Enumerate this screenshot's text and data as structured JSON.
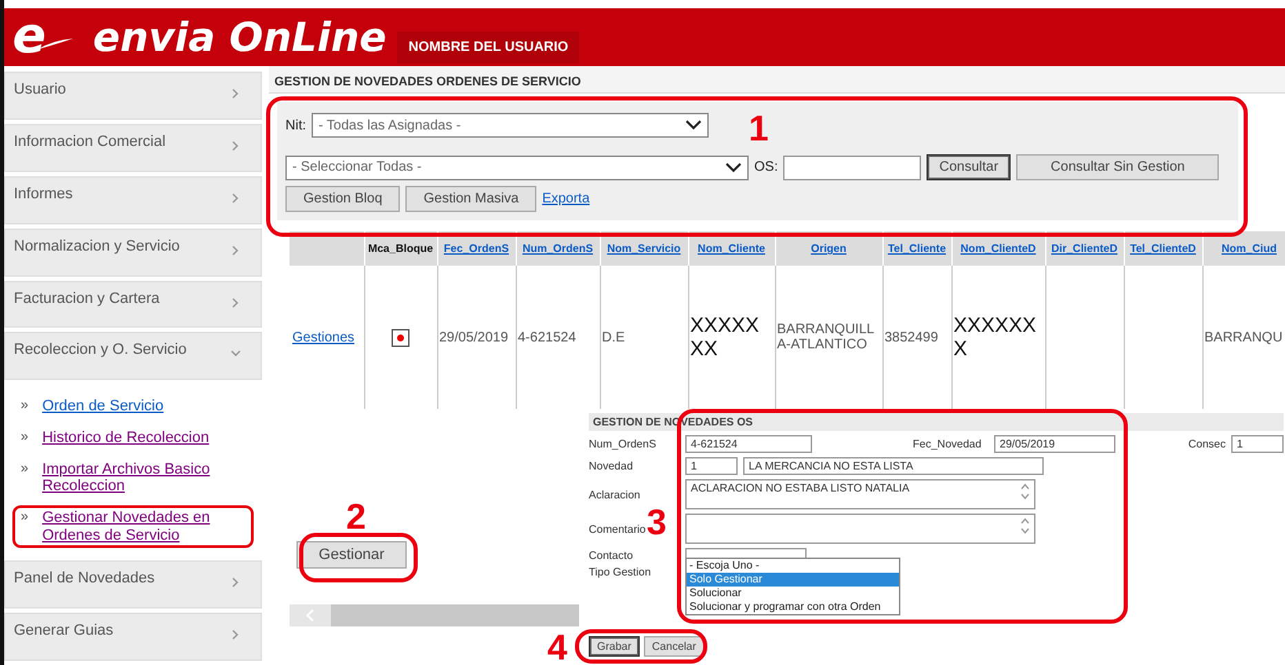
{
  "header": {
    "logo_mark": "e",
    "logo_text": "envia OnLine",
    "user_name": "NOMBRE DEL USUARIO"
  },
  "sidebar": {
    "items": [
      {
        "label": "Usuario",
        "expanded": false
      },
      {
        "label": "Informacion Comercial",
        "expanded": false
      },
      {
        "label": "Informes",
        "expanded": false
      },
      {
        "label": "Normalizacion y Servicio",
        "expanded": false
      },
      {
        "label": "Facturacion y Cartera",
        "expanded": false
      },
      {
        "label": "Recoleccion y O. Servicio",
        "expanded": true,
        "children": [
          {
            "bullet": "»",
            "label": "Orden de Servicio",
            "visited": false,
            "highlighted": false
          },
          {
            "bullet": "»",
            "label": "Historico de Recoleccion",
            "visited": true,
            "highlighted": false
          },
          {
            "bullet": "»",
            "label": "Importar Archivos Basico Recoleccion",
            "visited": true,
            "highlighted": false
          },
          {
            "bullet": "»",
            "label": "Gestionar Novedades en Ordenes de Servicio",
            "visited": true,
            "highlighted": true
          }
        ]
      },
      {
        "label": "Panel de Novedades",
        "expanded": false
      },
      {
        "label": "Generar Guias",
        "expanded": false
      }
    ]
  },
  "page_title": "GESTION DE NOVEDADES ORDENES DE SERVICIO",
  "filters": {
    "nit_label": "Nit:",
    "nit_select": "- Todas las Asignadas -",
    "service_select": "- Seleccionar Todas -",
    "os_label": "OS:",
    "buttons": [
      {
        "label": "Consultar",
        "focused": true
      },
      {
        "label": "Consultar Sin Gestion",
        "focused": false
      }
    ],
    "row2_buttons": [
      "Gestion Bloq",
      "Gestion Masiva"
    ],
    "export_link": "Exporta"
  },
  "table": {
    "columns": [
      {
        "kind": "blank"
      },
      {
        "label": "Mca_Bloque",
        "link": false
      },
      {
        "label": "Fec_OrdenS",
        "link": true
      },
      {
        "label": "Num_OrdenS",
        "link": true
      },
      {
        "label": "Nom_Servicio",
        "link": true
      },
      {
        "label": "Nom_Cliente",
        "link": true
      },
      {
        "label": "Origen",
        "link": true
      },
      {
        "label": "Tel_Cliente",
        "link": true
      },
      {
        "label": "Nom_ClienteD",
        "link": true
      },
      {
        "label": "Dir_ClienteD",
        "link": true
      },
      {
        "label": "Tel_ClienteD",
        "link": true
      },
      {
        "label": "Nom_Ciud",
        "link": true
      }
    ],
    "rows": [
      {
        "cells": [
          {
            "kind": "link",
            "text": "Gestiones"
          },
          {
            "kind": "flag",
            "blocked": true
          },
          {
            "kind": "plain",
            "text": "29/05/2019"
          },
          {
            "kind": "plain",
            "text": "4-621524"
          },
          {
            "kind": "plain",
            "text": "D.E"
          },
          {
            "kind": "masked",
            "text": "XXXXXXX"
          },
          {
            "kind": "plain",
            "text": "BARRANQUILLA-ATLANTICO"
          },
          {
            "kind": "plain",
            "text": "3852499"
          },
          {
            "kind": "masked",
            "text": "XXXXXXX"
          },
          {
            "kind": "empty"
          },
          {
            "kind": "empty"
          },
          {
            "kind": "plain",
            "text": "BARRANQU"
          }
        ]
      }
    ]
  },
  "gestionar_button": "Gestionar",
  "form": {
    "title": "GESTION DE NOVEDADES OS",
    "num_label": "Num_OrdenS",
    "num_value": "4-621524",
    "fec_label": "Fec_Novedad",
    "fec_value": "29/05/2019",
    "consec_label": "Consec",
    "consec_value": "1",
    "novedad_label": "Novedad",
    "novedad_code": "1",
    "novedad_text": "LA MERCANCIA NO ESTA LISTA",
    "aclaracion_label": "Aclaracion",
    "aclaracion_value": "ACLARACION NO ESTABA LISTO NATALIA",
    "comentario_label": "Comentario",
    "contacto_label": "Contacto",
    "tipo_label": "Tipo Gestion",
    "tipo_options": [
      {
        "label": "- Escoja Uno -",
        "selected": false
      },
      {
        "label": "Solo Gestionar",
        "selected": true
      },
      {
        "label": "Solucionar",
        "selected": false
      },
      {
        "label": "Solucionar y programar con otra Orden",
        "selected": false
      }
    ],
    "buttons": [
      {
        "label": "Grabar",
        "focused": true
      },
      {
        "label": "Cancelar",
        "focused": false
      }
    ]
  },
  "annotations": [
    {
      "label": "1"
    },
    {
      "label": "2"
    },
    {
      "label": "3"
    },
    {
      "label": "4"
    }
  ]
}
